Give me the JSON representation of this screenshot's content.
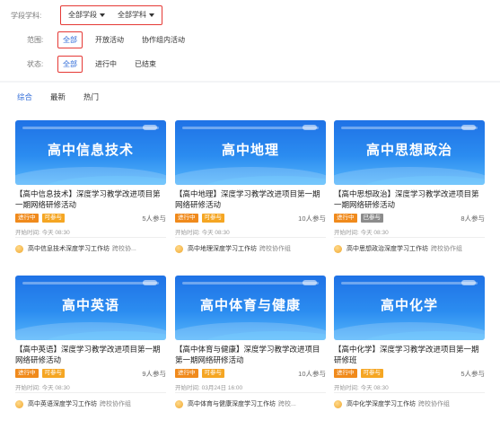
{
  "filters": {
    "subject_label": "学段学科:",
    "stage_value": "全部学段",
    "subject_value": "全部学科",
    "scope_label": "范围:",
    "scope_options": [
      "全部",
      "开放活动",
      "协作组内活动"
    ],
    "status_label": "状态:",
    "status_options": [
      "全部",
      "进行中",
      "已结束"
    ]
  },
  "tabs": [
    "综合",
    "最新",
    "热门"
  ],
  "colors": {
    "accent": "#2f6bd8",
    "highlight_box": "#e53935",
    "running": "#f08a1c",
    "joinable": "#f5a623",
    "full": "#8c8c8c"
  },
  "cards": [
    {
      "thumb_title": "高中信息技术",
      "title": "【高中信息技术】深度学习教学改进项目第一期网络研修活动",
      "status": "进行中",
      "join": "可参与",
      "join_type": "open",
      "count": "5人参与",
      "time": "开始时间: 今天 08:30",
      "studio": "高中信息技术深度学习工作坊",
      "studio_tag": "跨校协..."
    },
    {
      "thumb_title": "高中地理",
      "title": "【高中地理】深度学习教学改进项目第一期网络研修活动",
      "status": "进行中",
      "join": "可参与",
      "join_type": "open",
      "count": "10人参与",
      "time": "开始时间: 今天 08:30",
      "studio": "高中地理深度学习工作坊",
      "studio_tag": "跨校协作组"
    },
    {
      "thumb_title": "高中思想政治",
      "title": "【高中思想政治】深度学习教学改进项目第一期网络研修活动",
      "status": "进行中",
      "join": "已参与",
      "join_type": "full",
      "count": "8人参与",
      "time": "开始时间: 今天 08:30",
      "studio": "高中思想政治深度学习工作坊",
      "studio_tag": "跨校协作组"
    },
    {
      "thumb_title": "高中英语",
      "title": "【高中英语】深度学习教学改进项目第一期网络研修活动",
      "status": "进行中",
      "join": "可参与",
      "join_type": "open",
      "count": "9人参与",
      "time": "开始时间: 今天 08:30",
      "studio": "高中英语深度学习工作坊",
      "studio_tag": "跨校协作组"
    },
    {
      "thumb_title": "高中体育与健康",
      "title": "【高中体育与健康】深度学习教学改进项目第一期网络研修活动",
      "status": "进行中",
      "join": "可参与",
      "join_type": "open",
      "count": "10人参与",
      "time": "开始时间: 03月24日 16:00",
      "studio": "高中体育与健康深度学习工作坊",
      "studio_tag": "跨校..."
    },
    {
      "thumb_title": "高中化学",
      "title": "【高中化学】深度学习教学改进项目第一期研修班",
      "status": "进行中",
      "join": "可参与",
      "join_type": "open",
      "count": "5人参与",
      "time": "开始时间: 今天 08:30",
      "studio": "高中化学深度学习工作坊",
      "studio_tag": "跨校协作组"
    }
  ]
}
